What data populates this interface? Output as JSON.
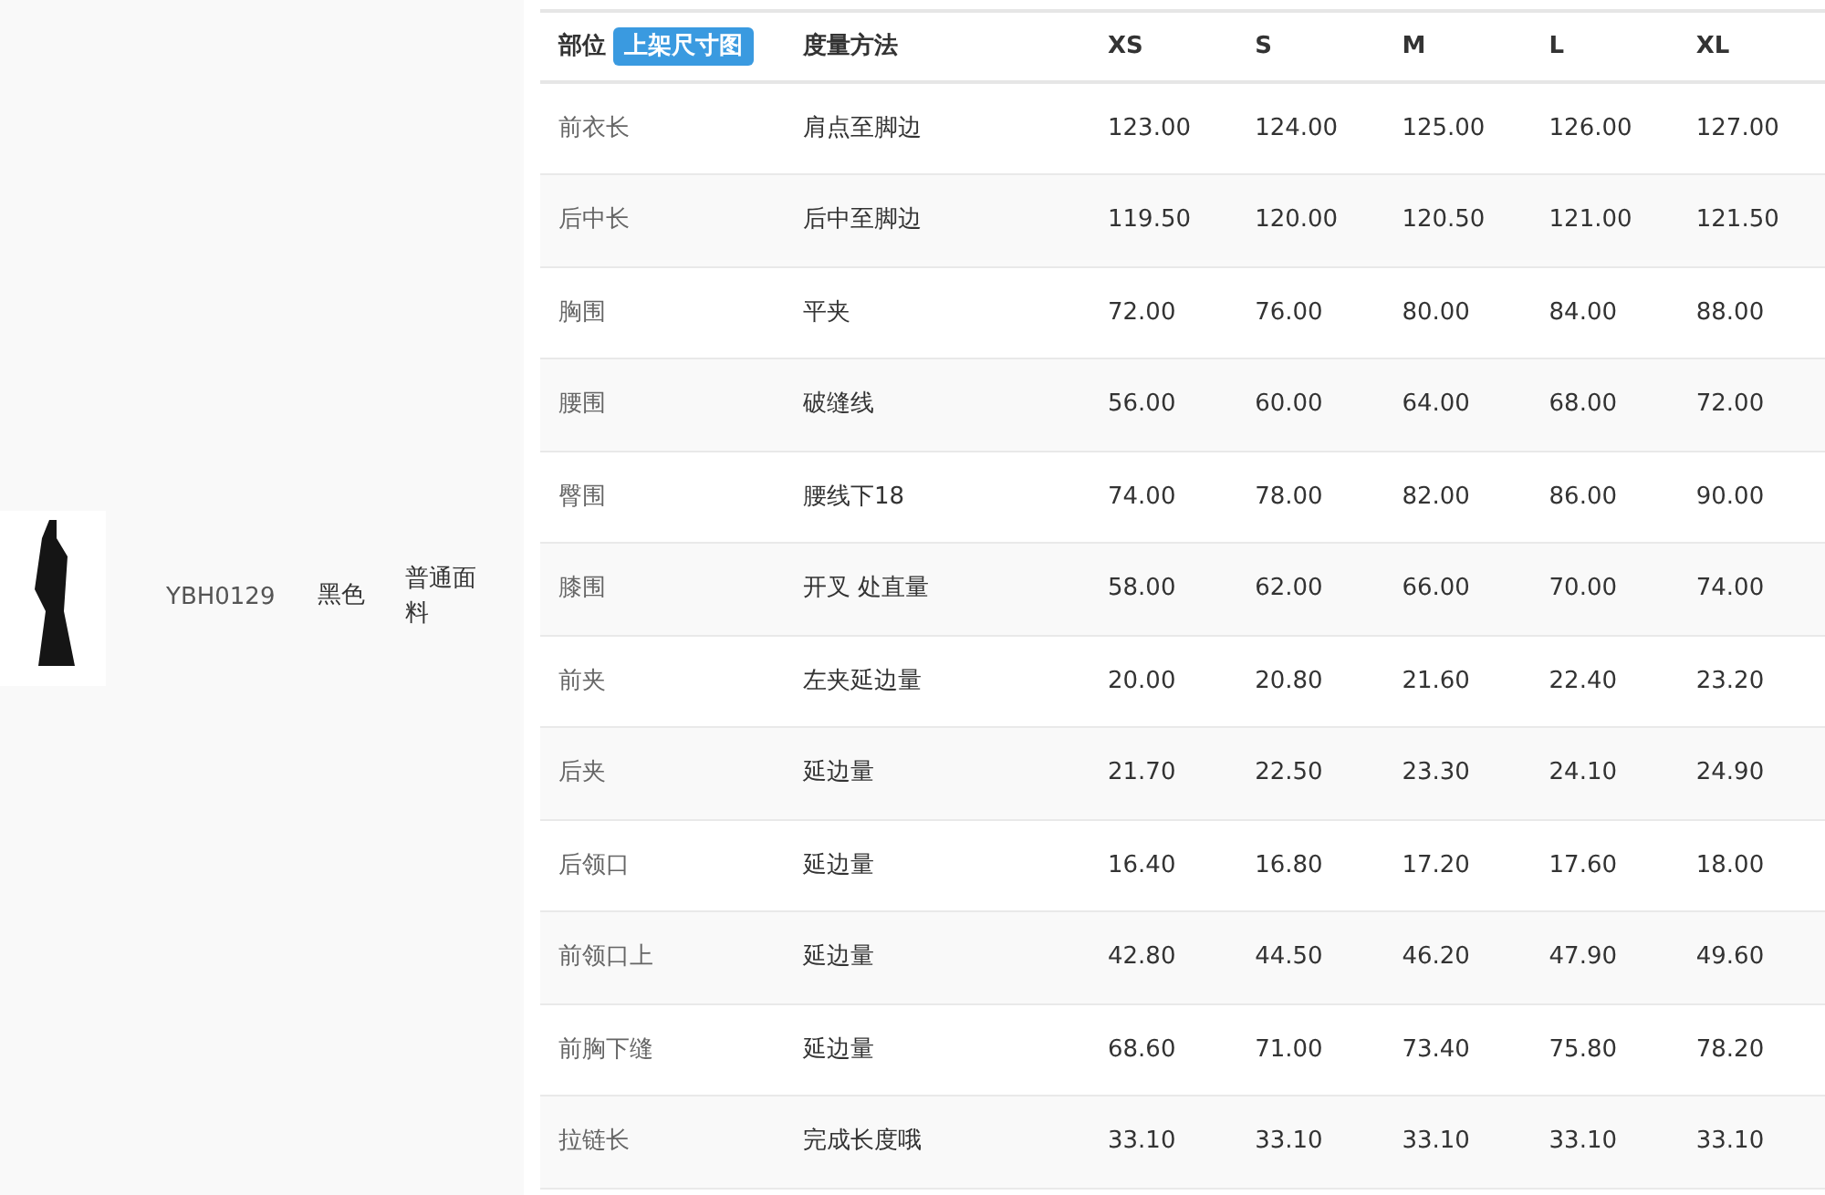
{
  "product": {
    "code": "YBH0129",
    "color_name": "黑色",
    "fabric": "普通面料"
  },
  "size_table": {
    "part_header": "部位",
    "chart_button": "上架尺寸图",
    "method_header": "度量方法",
    "sizes": [
      "XS",
      "S",
      "M",
      "L",
      "XL"
    ],
    "rows": [
      {
        "part": "前衣长",
        "method": "肩点至脚边",
        "values": [
          "123.00",
          "124.00",
          "125.00",
          "126.00",
          "127.00"
        ]
      },
      {
        "part": "后中长",
        "method": "后中至脚边",
        "values": [
          "119.50",
          "120.00",
          "120.50",
          "121.00",
          "121.50"
        ]
      },
      {
        "part": "胸围",
        "method": "平夹",
        "values": [
          "72.00",
          "76.00",
          "80.00",
          "84.00",
          "88.00"
        ]
      },
      {
        "part": "腰围",
        "method": "破缝线",
        "values": [
          "56.00",
          "60.00",
          "64.00",
          "68.00",
          "72.00"
        ]
      },
      {
        "part": "臀围",
        "method": "腰线下18",
        "values": [
          "74.00",
          "78.00",
          "82.00",
          "86.00",
          "90.00"
        ]
      },
      {
        "part": "膝围",
        "method": "开叉 处直量",
        "values": [
          "58.00",
          "62.00",
          "66.00",
          "70.00",
          "74.00"
        ]
      },
      {
        "part": "前夹",
        "method": "左夹延边量",
        "values": [
          "20.00",
          "20.80",
          "21.60",
          "22.40",
          "23.20"
        ]
      },
      {
        "part": "后夹",
        "method": "延边量",
        "values": [
          "21.70",
          "22.50",
          "23.30",
          "24.10",
          "24.90"
        ]
      },
      {
        "part": "后领口",
        "method": "延边量",
        "values": [
          "16.40",
          "16.80",
          "17.20",
          "17.60",
          "18.00"
        ]
      },
      {
        "part": "前领口上",
        "method": "延边量",
        "values": [
          "42.80",
          "44.50",
          "46.20",
          "47.90",
          "49.60"
        ]
      },
      {
        "part": "前胸下缝",
        "method": "延边量",
        "values": [
          "68.60",
          "71.00",
          "73.40",
          "75.80",
          "78.20"
        ]
      },
      {
        "part": "拉链长",
        "method": "完成长度哦",
        "values": [
          "33.10",
          "33.10",
          "33.10",
          "33.10",
          "33.10"
        ]
      }
    ]
  }
}
